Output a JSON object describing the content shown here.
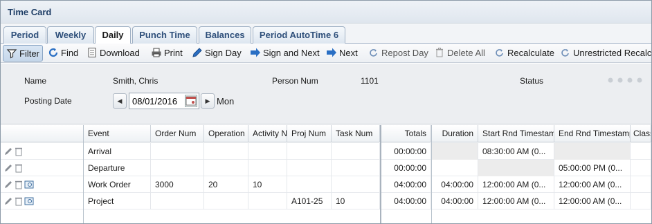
{
  "window": {
    "title": "Time Card"
  },
  "tabs": [
    {
      "label": "Period"
    },
    {
      "label": "Weekly"
    },
    {
      "label": "Daily"
    },
    {
      "label": "Punch Time"
    },
    {
      "label": "Balances"
    },
    {
      "label": "Period AutoTime 6"
    }
  ],
  "toolbar": {
    "filter": "Filter",
    "find": "Find",
    "download": "Download",
    "print": "Print",
    "sign_day": "Sign Day",
    "sign_and_next": "Sign and Next",
    "next": "Next",
    "repost_day": "Repost Day",
    "delete_all": "Delete All",
    "recalculate": "Recalculate",
    "unrestricted_recalc": "Unrestricted Recalc"
  },
  "header": {
    "name_label": "Name",
    "name_value": "Smith, Chris",
    "person_num_label": "Person Num",
    "person_num_value": "1101",
    "status_label": "Status",
    "posting_date_label": "Posting Date",
    "posting_date_value": "08/01/2016",
    "day_of_week": "Mon"
  },
  "grid": {
    "columns": {
      "event": "Event",
      "order_num": "Order Num",
      "operation": "Operation",
      "activity": "Activity N",
      "proj_num": "Proj Num",
      "task_num": "Task Num",
      "totals": "Totals",
      "duration": "Duration",
      "start_rnd": "Start Rnd Timestam",
      "end_rnd": "End Rnd Timestamp",
      "class": "Class"
    },
    "rows": [
      {
        "event": "Arrival",
        "order_num": "",
        "operation": "",
        "activity": "",
        "proj_num": "",
        "task_num": "",
        "totals": "00:00:00",
        "duration": "",
        "start_rnd": "08:30:00 AM (0...",
        "end_rnd": ""
      },
      {
        "event": "Departure",
        "order_num": "",
        "operation": "",
        "activity": "",
        "proj_num": "",
        "task_num": "",
        "totals": "00:00:00",
        "duration": "",
        "start_rnd": "",
        "end_rnd": "05:00:00 PM (0..."
      },
      {
        "event": "Work Order",
        "order_num": "3000",
        "operation": "20",
        "activity": "10",
        "proj_num": "",
        "task_num": "",
        "totals": "04:00:00",
        "duration": "04:00:00",
        "start_rnd": "12:00:00 AM (0...",
        "end_rnd": "12:00:00 AM (0..."
      },
      {
        "event": "Project",
        "order_num": "",
        "operation": "",
        "activity": "",
        "proj_num": "A101-25",
        "task_num": "10",
        "totals": "04:00:00",
        "duration": "04:00:00",
        "start_rnd": "12:00:00 AM (0...",
        "end_rnd": "12:00:00 AM (0..."
      }
    ]
  }
}
